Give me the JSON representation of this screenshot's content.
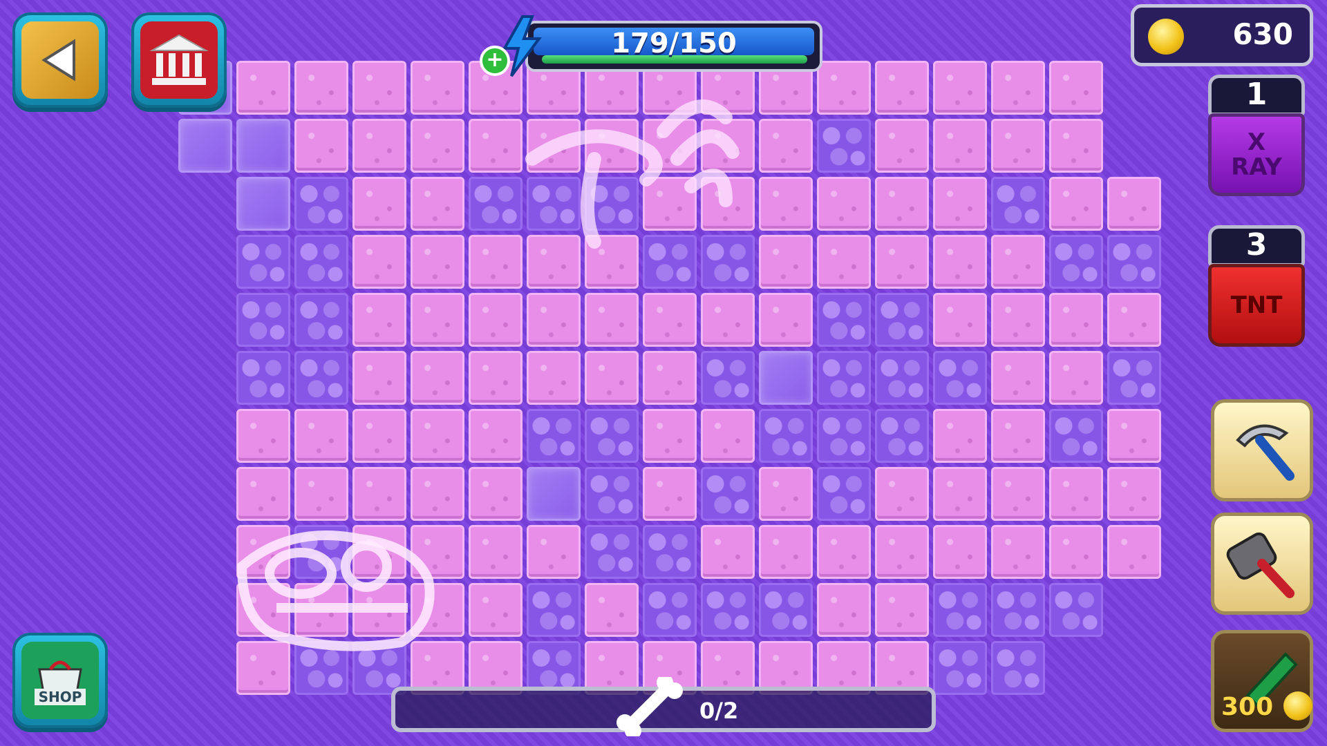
{
  "hud": {
    "energy": {
      "text": "179/150",
      "current": 179,
      "max": 150
    },
    "coins": {
      "value": "630"
    },
    "excavation_progress": {
      "text": "0/2"
    }
  },
  "buttons": {
    "back": {
      "icon": "back-arrow-icon"
    },
    "museum": {
      "icon": "museum-icon"
    },
    "shop": {
      "label": "SHOP"
    },
    "energy_add": {
      "label": "+"
    }
  },
  "powerups": {
    "xray": {
      "count": "1",
      "label": "X RAY"
    },
    "tnt": {
      "count": "3",
      "label": "TNT"
    },
    "drill_cost": "300"
  },
  "tiles": [
    "..CDDDDDDDDDDDDDDD..",
    "..CCDDDDDDDDDRDDDD..",
    "...CRDDRRRDDDDDDRDDD",
    "...RRDDDDDRRDDDDDRRD",
    "...RRDDDDDDDDRRDDDDCC",
    "...RRDDDDDDRCRRRDDRC",
    "...DDDDDRRDDRRRDDRDDR",
    "...DDDDDCRDRDRDDDDDD.",
    "...DRDDDDRRDDDDDDDDD.",
    "...DDDDDRDRRRDDRRR..",
    "...DRRDDRDDDDDDRR...",
    "....DRR.............."
  ],
  "colors": {
    "background": "#7b3fe0",
    "dirt": "#e88ee8",
    "rock": "#8656e6",
    "energy": "#1659c9",
    "coin": "#f2c21a",
    "tnt": "#d81d1d",
    "xray": "#8a1dc9"
  }
}
